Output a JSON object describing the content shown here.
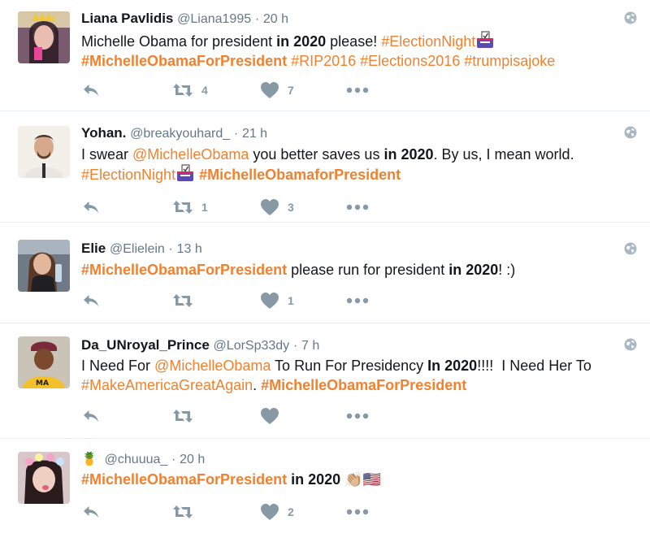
{
  "tweets": [
    {
      "name": "Liana Pavlidis",
      "handle": "@Liana1995",
      "sep": "·",
      "time": "20 h",
      "t1": "Michelle Obama for president ",
      "t2": "in 2020",
      "t3": " please! ",
      "t4": "#ElectionNight",
      "t5": "#MichelleObamaForPresident",
      "t6": " #RIP2016 #Elections2016 #trumpisajoke",
      "retweets": "4",
      "likes": "7"
    },
    {
      "name": "Yohan.",
      "handle": "@breakyouhard_",
      "sep": "·",
      "time": "21 h",
      "t1": "I swear ",
      "t2": "@MichelleObama",
      "t3": " you better saves us ",
      "t4": "in 2020",
      "t5": ". By us, I mean world.",
      "t6": "#ElectionNight",
      "t7": "#MichelleObamaforPresident",
      "retweets": "1",
      "likes": "3"
    },
    {
      "name": "Elie",
      "handle": "@Elielein",
      "sep": "·",
      "time": "13 h",
      "t1": "#MichelleObamaForPresident",
      "t2": " please run for president ",
      "t3": "in 2020",
      "t4": "! :)",
      "retweets": "",
      "likes": "1"
    },
    {
      "name": "Da_UNroyal_Prince",
      "handle": "@LorSp33dy",
      "sep": "·",
      "time": "7 h",
      "t1": "I Need For ",
      "t2": "@MichelleObama",
      "t3": " To Run For Presidency ",
      "t4": "In 2020",
      "t5": "!!!!  I Need Her To",
      "t6": "#MakeAmericaGreatAgain",
      "t7": ". ",
      "t8": "#MichelleObamaForPresident",
      "retweets": "",
      "likes": ""
    },
    {
      "name": "🍍",
      "handle": "@chuuua_",
      "sep": "·",
      "time": "20 h",
      "t1": "#MichelleObamaForPresident",
      "t2": " in 2020 ",
      "t3": "👏🏼🇺🇸",
      "retweets": "",
      "likes": "2"
    }
  ],
  "icons": {
    "reply": "reply-icon",
    "retweet": "retweet-icon",
    "like": "heart-icon",
    "more": "more-icon",
    "globe": "globe-icon"
  },
  "colors": {
    "hashtag": "#f1812f",
    "muted": "#8899a6",
    "divider": "#e6ecf0"
  }
}
